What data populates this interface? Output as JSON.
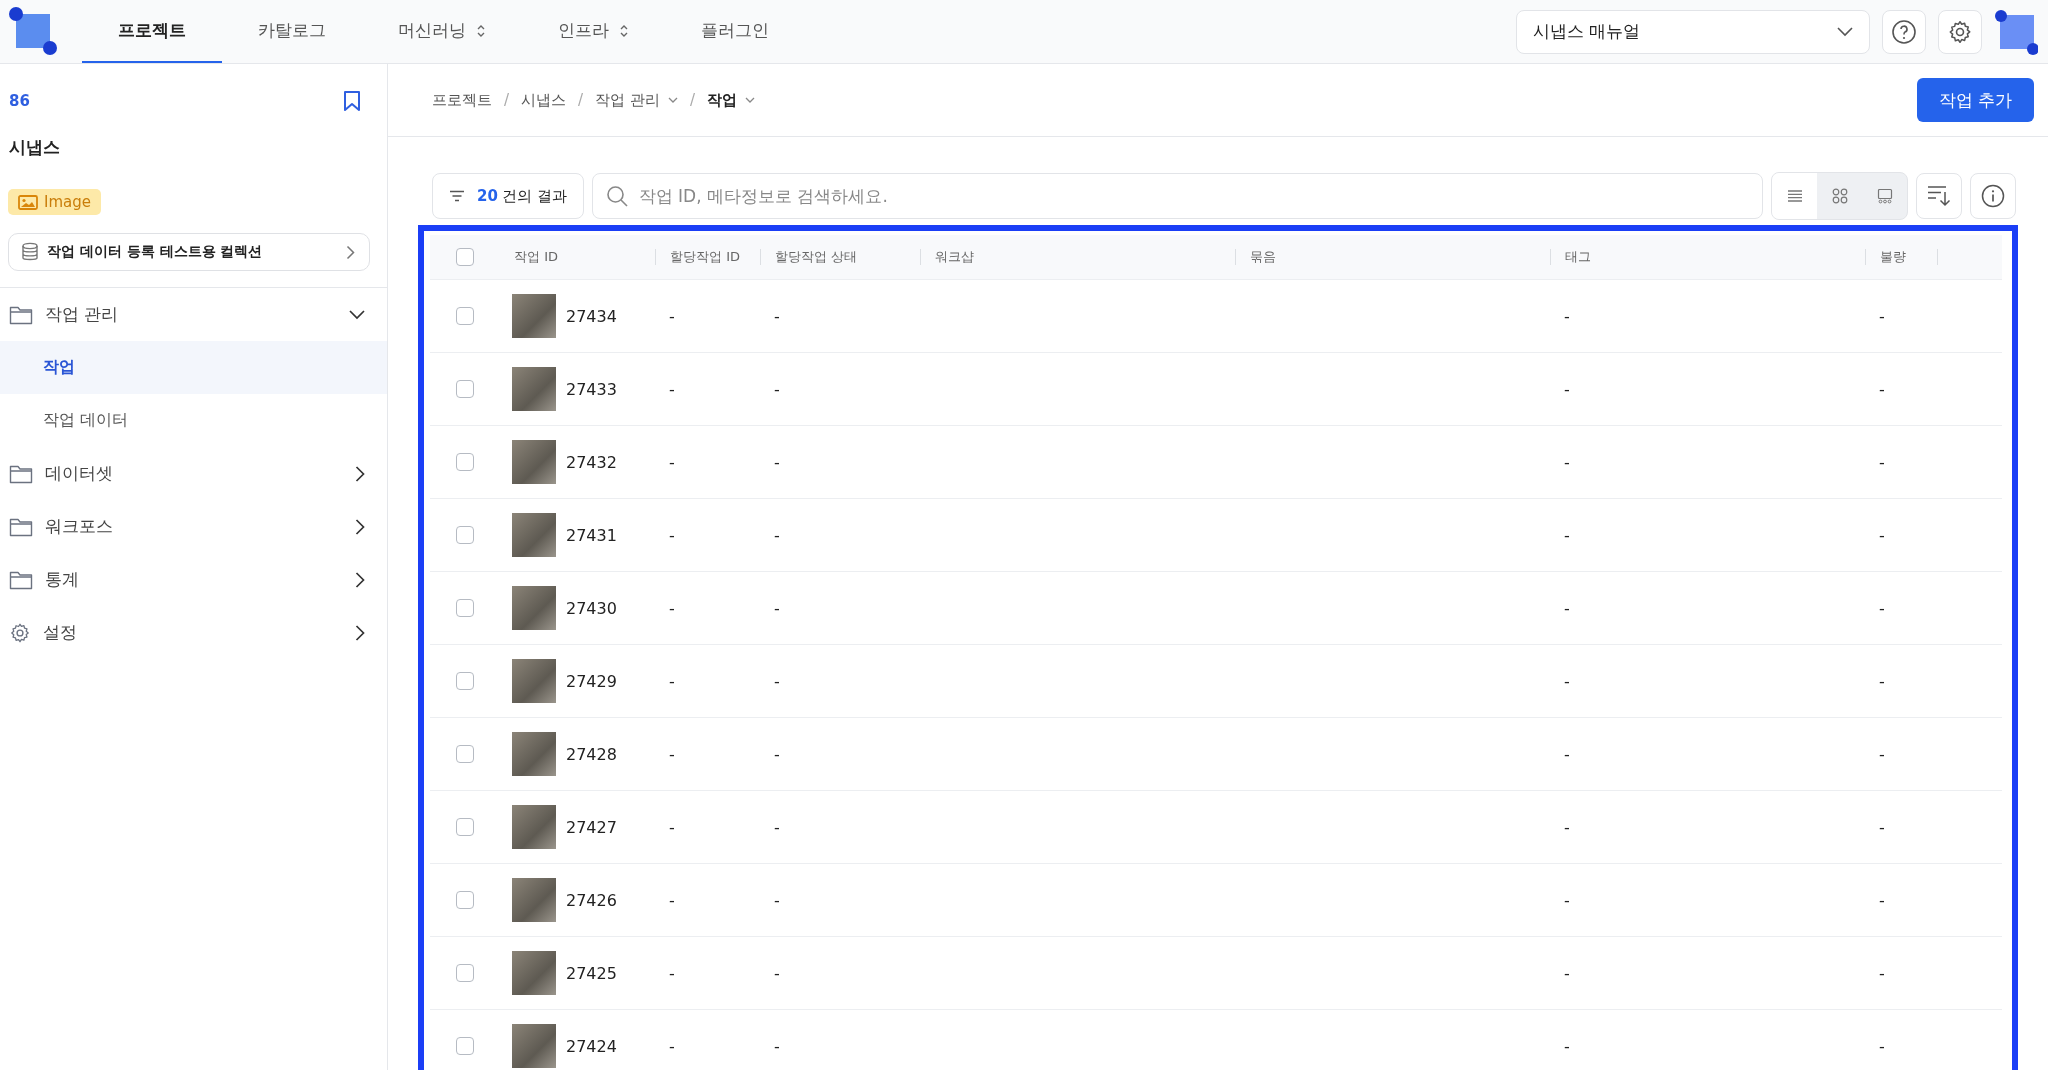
{
  "top_nav": {
    "tabs": [
      {
        "label": "프로젝트",
        "selected": true,
        "has_menu": false
      },
      {
        "label": "카탈로그",
        "selected": false,
        "has_menu": false
      },
      {
        "label": "머신러닝",
        "selected": false,
        "has_menu": true
      },
      {
        "label": "인프라",
        "selected": false,
        "has_menu": true
      },
      {
        "label": "플러그인",
        "selected": false,
        "has_menu": false
      }
    ],
    "project_select": {
      "value": "시냅스 매뉴얼"
    }
  },
  "sidebar": {
    "project_id": "86",
    "project_name": "시냅스",
    "type_badge": "Image",
    "collection": "작업 데이터 등록 테스트용 컬렉션",
    "menu": [
      {
        "label": "작업 관리",
        "kind": "folder",
        "expanded": true,
        "children": [
          {
            "label": "작업",
            "selected": true
          },
          {
            "label": "작업 데이터",
            "selected": false
          }
        ]
      },
      {
        "label": "데이터셋",
        "kind": "folder",
        "expanded": false
      },
      {
        "label": "워크포스",
        "kind": "folder",
        "expanded": false
      },
      {
        "label": "통계",
        "kind": "folder",
        "expanded": false
      },
      {
        "label": "설정",
        "kind": "gear",
        "expanded": false
      }
    ]
  },
  "breadcrumb": [
    {
      "label": "프로젝트",
      "has_menu": false,
      "current": false
    },
    {
      "separator": "/",
      "label": "시냅스",
      "has_menu": false,
      "current": false
    },
    {
      "separator": "/",
      "label": "작업 관리",
      "has_menu": true,
      "current": false
    },
    {
      "separator": "/",
      "label": "작업",
      "has_menu": true,
      "current": true
    }
  ],
  "add_button": "작업 추가",
  "toolbar": {
    "result_count": "20",
    "result_suffix": "건의 결과",
    "search_placeholder": "작업 ID, 메타정보로 검색하세요.",
    "view_modes": [
      {
        "kind": "list",
        "selected": true
      },
      {
        "kind": "grid",
        "selected": false
      },
      {
        "kind": "gallery",
        "selected": false
      }
    ]
  },
  "table": {
    "select_all_checked": false,
    "columns": [
      "작업 ID",
      "할당작업 ID",
      "할당작업 상태",
      "워크샵",
      "묶음",
      "태그",
      "불량"
    ],
    "rows": [
      {
        "id": "27434",
        "assigned_id": "-",
        "status": "-",
        "tag": "-",
        "defect": "-",
        "checked": false
      },
      {
        "id": "27433",
        "assigned_id": "-",
        "status": "-",
        "tag": "-",
        "defect": "-",
        "checked": false
      },
      {
        "id": "27432",
        "assigned_id": "-",
        "status": "-",
        "tag": "-",
        "defect": "-",
        "checked": false
      },
      {
        "id": "27431",
        "assigned_id": "-",
        "status": "-",
        "tag": "-",
        "defect": "-",
        "checked": false
      },
      {
        "id": "27430",
        "assigned_id": "-",
        "status": "-",
        "tag": "-",
        "defect": "-",
        "checked": false
      },
      {
        "id": "27429",
        "assigned_id": "-",
        "status": "-",
        "tag": "-",
        "defect": "-",
        "checked": false
      },
      {
        "id": "27428",
        "assigned_id": "-",
        "status": "-",
        "tag": "-",
        "defect": "-",
        "checked": false
      },
      {
        "id": "27427",
        "assigned_id": "-",
        "status": "-",
        "tag": "-",
        "defect": "-",
        "checked": false
      },
      {
        "id": "27426",
        "assigned_id": "-",
        "status": "-",
        "tag": "-",
        "defect": "-",
        "checked": false
      },
      {
        "id": "27425",
        "assigned_id": "-",
        "status": "-",
        "tag": "-",
        "defect": "-",
        "checked": false
      },
      {
        "id": "27424",
        "assigned_id": "-",
        "status": "-",
        "tag": "-",
        "defect": "-",
        "checked": false
      }
    ]
  }
}
